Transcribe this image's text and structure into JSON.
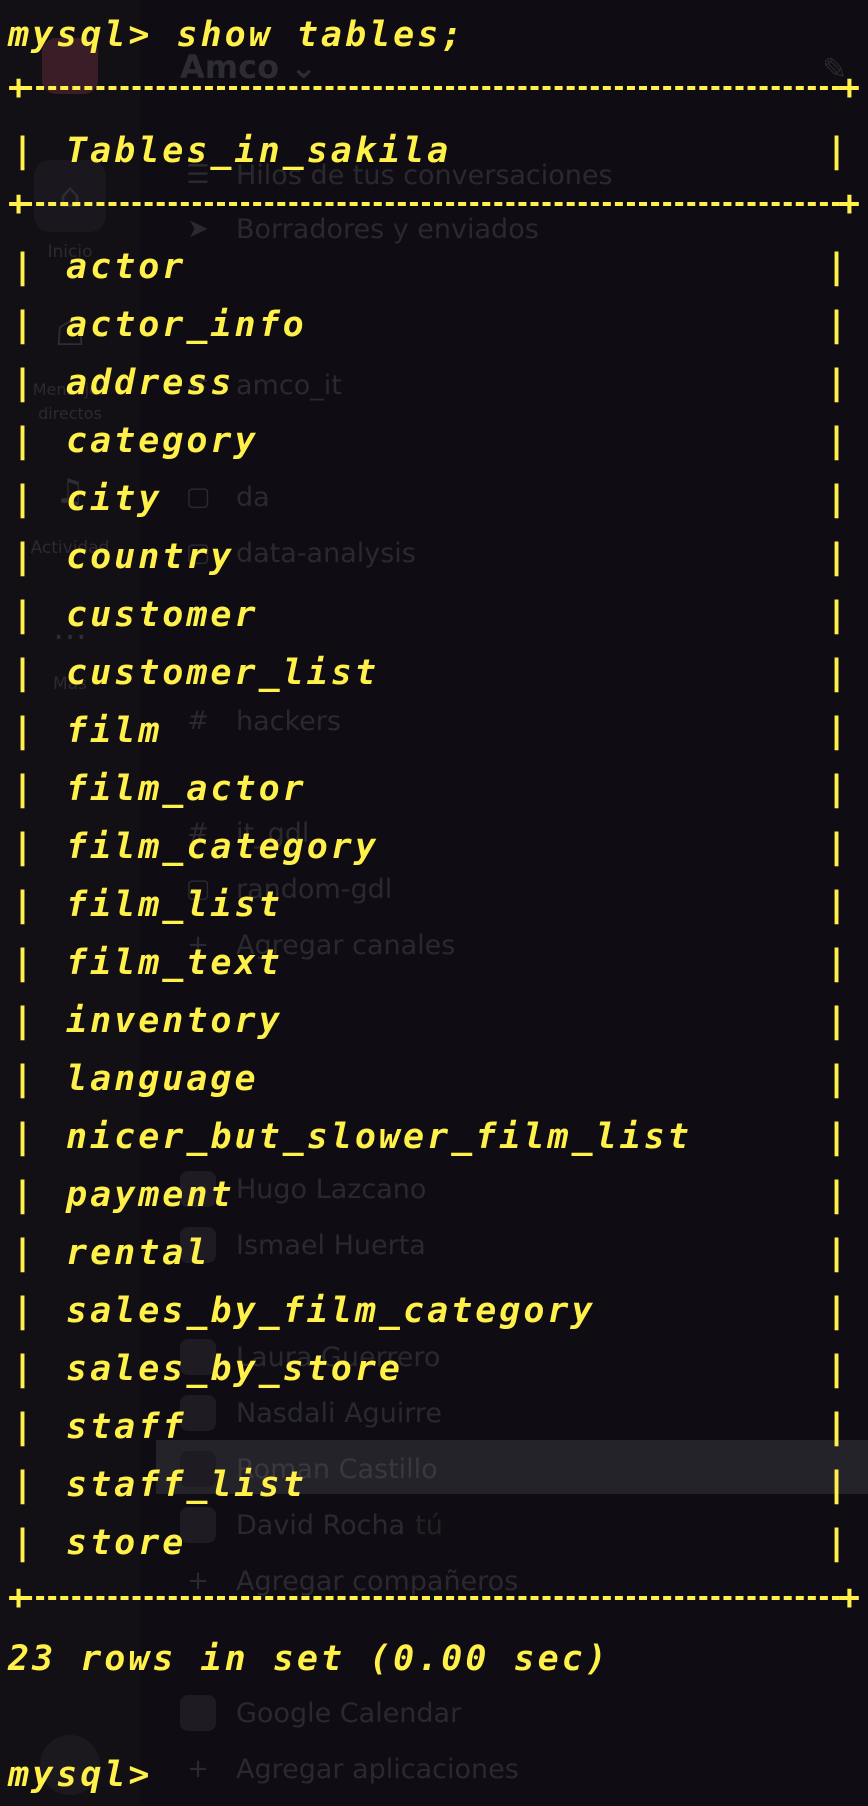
{
  "terminal": {
    "command_line": "mysql> show tables;",
    "header": "Tables_in_sakila",
    "rows": [
      "actor",
      "actor_info",
      "address",
      "category",
      "city",
      "country",
      "customer",
      "customer_list",
      "film",
      "film_actor",
      "film_category",
      "film_list",
      "film_text",
      "inventory",
      "language",
      "nicer_but_slower_film_list",
      "payment",
      "rental",
      "sales_by_film_category",
      "sales_by_store",
      "staff",
      "staff_list",
      "store"
    ],
    "summary": "23 rows in set (0.00 sec)",
    "prompt": "mysql>",
    "text_color": "#fff04a",
    "background_color": "#0e0c12"
  },
  "background_app": {
    "workspace_name": "Amco",
    "rail": [
      {
        "label": "Inicio",
        "icon": "home-icon"
      },
      {
        "label": "Mensajes directos",
        "icon": "chat-bubbles-icon"
      },
      {
        "label": "Actividad",
        "icon": "bell-icon"
      },
      {
        "label": "Más",
        "icon": "ellipsis-icon"
      }
    ],
    "sidebar_items": [
      {
        "label": "Hilos de tus conversaciones",
        "icon": "threads-icon"
      },
      {
        "label": "Borradores y enviados",
        "icon": "send-icon"
      },
      {
        "label": "amco_it",
        "icon": "hash-icon"
      },
      {
        "label": "da",
        "icon": "lock-icon"
      },
      {
        "label": "data-analysis",
        "icon": "lock-icon"
      },
      {
        "label": "hackers",
        "icon": "hash-icon"
      },
      {
        "label": "it_gdl",
        "icon": "hash-icon"
      },
      {
        "label": "random-gdl",
        "icon": "lock-icon"
      },
      {
        "label": "Agregar canales",
        "icon": "plus-icon"
      }
    ],
    "dm_people": [
      "Hugo Lazcano",
      "Ismael Huerta",
      "Laura Guerrero",
      "Nasdali Aguirre",
      "Roman Castillo",
      "David Rocha"
    ],
    "you_label": "tú",
    "add_teammates": "Agregar compañeros",
    "app_calendar": "Google Calendar",
    "add_apps": "Agregar aplicaciones"
  }
}
